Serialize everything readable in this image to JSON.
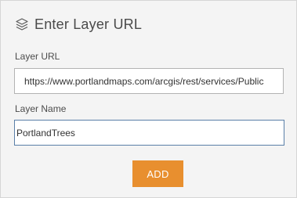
{
  "header": {
    "icon": "layers-icon",
    "title": "Enter Layer URL"
  },
  "fields": {
    "layer_url": {
      "label": "Layer URL",
      "value": "https://www.portlandmaps.com/arcgis/rest/services/Public"
    },
    "layer_name": {
      "label": "Layer Name",
      "value": "PortlandTrees"
    }
  },
  "actions": {
    "add_label": "ADD"
  },
  "colors": {
    "panel_background": "#f4f4f4",
    "add_button": "#e88f2f",
    "focus_border": "#5a7fa8"
  }
}
